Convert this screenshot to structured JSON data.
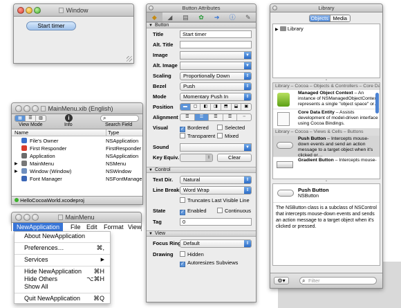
{
  "window1": {
    "title": "Window",
    "button": "Start timer"
  },
  "mainmenu_xib": {
    "title": "MainMenu.xib (English)",
    "toolbar": {
      "view_mode": "View Mode",
      "info": "Info",
      "search": "Search Field"
    },
    "columns": {
      "name": "Name",
      "type": "Type"
    },
    "rows": [
      {
        "name": "File's Owner",
        "type": "NSApplication",
        "color": "#3a6fc9"
      },
      {
        "name": "First Responder",
        "type": "FirstResponder",
        "color": "#d93c2c"
      },
      {
        "name": "Application",
        "type": "NSApplication",
        "color": "#6b6b6b"
      },
      {
        "name": "MainMenu",
        "type": "NSMenu",
        "color": "#777777"
      },
      {
        "name": "Window (Window)",
        "type": "NSWindow",
        "color": "#6f8fbf"
      },
      {
        "name": "Font Manager",
        "type": "NSFontManager",
        "color": "#3b66b6"
      }
    ],
    "status": "HelloCocoaWorld.xcodeproj"
  },
  "mainmenu": {
    "title": "MainMenu",
    "bar": {
      "app": "NewApplication",
      "file": "File",
      "edit": "Edit",
      "format": "Format",
      "view": "View"
    },
    "items": {
      "about": "About NewApplication",
      "preferences": "Preferences…",
      "preferences_sc": "⌘,",
      "services": "Services",
      "hide": "Hide NewApplication",
      "hide_sc": "⌘H",
      "hide_others": "Hide Others",
      "hide_others_sc": "⌥⌘H",
      "show_all": "Show All",
      "quit": "Quit NewApplication",
      "quit_sc": "⌘Q"
    }
  },
  "inspector": {
    "title": "Button Attributes",
    "sections": {
      "button": "Button",
      "control": "Control",
      "view": "View"
    },
    "labels": {
      "title": "Title",
      "alt_title": "Alt. Title",
      "image": "Image",
      "alt_image": "Alt. Image",
      "scaling": "Scaling",
      "bezel": "Bezel",
      "mode": "Mode",
      "position": "Position",
      "alignment": "Alignment",
      "visual": "Visual",
      "sound": "Sound",
      "key_equiv": "Key Equiv.",
      "text_dir": "Text Dir.",
      "line_breaks": "Line Breaks",
      "state": "State",
      "tag": "Tag",
      "focus_ring": "Focus Ring",
      "drawing": "Drawing"
    },
    "values": {
      "title": "Start timer",
      "alt_title": "",
      "image": "",
      "alt_image": "",
      "scaling": "Proportionally Down",
      "bezel": "Push",
      "mode": "Momentary Push In",
      "sound": "",
      "clear": "Clear",
      "text_dir": "Natural",
      "line_breaks": "Word Wrap",
      "tag": "0",
      "focus_ring": "Default"
    },
    "checks": {
      "bordered": "Bordered",
      "selected": "Selected",
      "transparent": "Transparent",
      "mixed": "Mixed",
      "truncates": "Truncates Last Visible Line",
      "enabled": "Enabled",
      "continuous": "Continuous",
      "hidden": "Hidden",
      "autoresizes": "Autoresizes Subviews"
    }
  },
  "library": {
    "title": "Library",
    "tabs": {
      "objects": "Objects",
      "media": "Media"
    },
    "tree_root": "Library",
    "group1": "Library – Cocoa – Objects & Controllers – Core Data",
    "items1": [
      {
        "title": "Managed Object Context",
        "desc": " – An instance of NSManagedObjectContext represents a single \"object space\" or…"
      },
      {
        "title": "Core Data Entity",
        "desc": " – Assists development of model-driven interface using Cocoa Bindings."
      }
    ],
    "group2": "Library – Cocoa – Views & Cells – Buttons",
    "items2": [
      {
        "title": "Push Button",
        "desc": " – Intercepts mouse-down events and send an action message to a target object when it's clicked or…"
      },
      {
        "title": "Gradient Button",
        "desc": " – Intercepts mouse-"
      }
    ],
    "detail_title": "Push Button",
    "detail_class": "NSButton",
    "detail_desc": "The NSButton class is a subclass of NSControl that intercepts mouse-down events and sends an action message to a target object when it's clicked or pressed.",
    "filter_placeholder": "Filter"
  }
}
